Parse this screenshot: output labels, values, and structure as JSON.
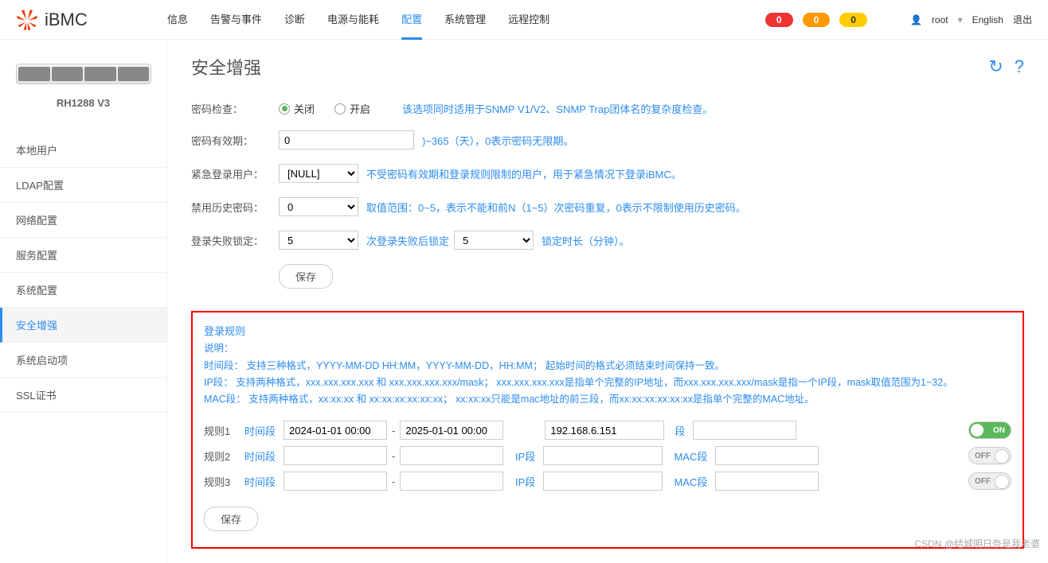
{
  "brand": "iBMC",
  "topnav": [
    "信息",
    "告警与事件",
    "诊断",
    "电源与能耗",
    "配置",
    "系统管理",
    "远程控制"
  ],
  "topnav_active": 4,
  "badges": {
    "critical": "0",
    "major": "0",
    "minor": "0"
  },
  "user": "root",
  "language": "English",
  "logout": "退出",
  "device": {
    "name": "RH1288 V3"
  },
  "sidenav": [
    "本地用户",
    "LDAP配置",
    "网络配置",
    "服务配置",
    "系统配置",
    "安全增强",
    "系统启动项",
    "SSL证书"
  ],
  "sidenav_active": 5,
  "page_title": "安全增强",
  "form": {
    "pwd_check_label": "密码检查：",
    "pwd_check_off": "关闭",
    "pwd_check_on": "开启",
    "pwd_check_hint": "该选项同时适用于SNMP V1/V2、SNMP Trap团体名的复杂度检查。",
    "pwd_valid_label": "密码有效期：",
    "pwd_valid_value": "0",
    "pwd_valid_hint": ")~365（天），0表示密码无限期。",
    "emerg_label": "紧急登录用户：",
    "emerg_value": "[NULL]",
    "emerg_hint": "不受密码有效期和登录规则限制的用户，用于紧急情况下登录iBMC。",
    "hist_label": "禁用历史密码：",
    "hist_value": "0",
    "hist_hint": "取值范围：0~5，表示不能和前N（1~5）次密码重复，0表示不限制使用历史密码。",
    "lock_label": "登录失败锁定：",
    "lock_fail_value": "5",
    "lock_mid_text": "次登录失败后锁定",
    "lock_dur_value": "5",
    "lock_tail_text": "锁定时长（分钟）。",
    "save_btn": "保存"
  },
  "rules": {
    "title": "登录规则",
    "desc_label": "说明：",
    "desc_time": "时间段： 支持三种格式，YYYY-MM-DD HH:MM，YYYY-MM-DD，HH:MM； 起始时间的格式必须结束时间保持一致。",
    "desc_ip": "IP段： 支持两种格式，xxx.xxx.xxx.xxx 和 xxx.xxx.xxx.xxx/mask； xxx.xxx.xxx.xxx是指单个完整的IP地址，而xxx.xxx.xxx.xxx/mask是指一个IP段，mask取值范围为1~32。",
    "desc_mac": "MAC段： 支持两种格式，xx:xx:xx 和 xx:xx:xx:xx:xx:xx； xx:xx:xx只能是mac地址的前三段，而xx:xx:xx:xx:xx:xx是指单个完整的MAC地址。",
    "col_time": "时间段",
    "col_ip": "IP段",
    "col_mac": "MAC段",
    "seg_generic": "段",
    "toggle_on": "ON",
    "toggle_off": "OFF",
    "rows": [
      {
        "label": "规则1",
        "t1": "2024-01-01 00:00",
        "t2": "2025-01-01 00:00",
        "ip": "192.168.6.151",
        "mac": "",
        "on": true,
        "seg_label": "段"
      },
      {
        "label": "规则2",
        "t1": "",
        "t2": "",
        "ip": "",
        "mac": "",
        "on": false,
        "seg_label": "MAC段"
      },
      {
        "label": "规则3",
        "t1": "",
        "t2": "",
        "ip": "",
        "mac": "",
        "on": false,
        "seg_label": "MAC段"
      }
    ],
    "save_btn": "保存"
  },
  "watermark": "CSDN @结城明日奈是我老婆"
}
